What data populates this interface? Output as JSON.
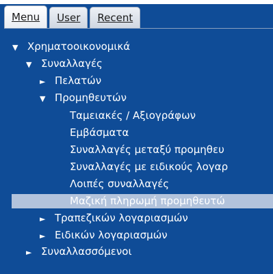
{
  "tabs": [
    {
      "key": "menu",
      "label": "Menu",
      "active": true
    },
    {
      "key": "user",
      "label": "User",
      "active": false
    },
    {
      "key": "recent",
      "label": "Recent",
      "active": false
    }
  ],
  "tree": [
    {
      "label": "Χρηματοοικονομικά",
      "icon": "expanded-triangle-icon",
      "glyph": "▼"
    },
    {
      "label": "Συναλλαγές",
      "icon": "expanded-triangle-icon",
      "glyph": "▼"
    },
    {
      "label": "Πελατών",
      "icon": "collapsed-triangle-icon",
      "glyph": "►"
    },
    {
      "label": "Προμηθευτών",
      "icon": "expanded-triangle-icon",
      "glyph": "▼"
    },
    {
      "label": "Ταμειακές / Αξιογράφων",
      "icon": "",
      "glyph": ""
    },
    {
      "label": "Εμβάσματα",
      "icon": "",
      "glyph": ""
    },
    {
      "label": "Συναλλαγές μεταξύ προμηθευ",
      "icon": "",
      "glyph": ""
    },
    {
      "label": "Συναλλαγές με ειδικούς λογαρ",
      "icon": "",
      "glyph": ""
    },
    {
      "label": "Λοιπές συναλλαγές",
      "icon": "",
      "glyph": ""
    },
    {
      "label": "Μαζική πληρωμή προμηθευτώ",
      "icon": "",
      "glyph": "",
      "selected": true
    },
    {
      "label": "Τραπεζικών λογαριασμών",
      "icon": "collapsed-triangle-icon",
      "glyph": "►"
    },
    {
      "label": "Ειδικών λογαριασμών",
      "icon": "collapsed-triangle-icon",
      "glyph": "►"
    },
    {
      "label": "Συναλλασσόμενοι",
      "icon": "collapsed-triangle-icon",
      "glyph": "►"
    }
  ],
  "colors": {
    "panel_background": "#0f4c97",
    "selected_row": "#b2c3dc",
    "text": "#ffffff"
  }
}
